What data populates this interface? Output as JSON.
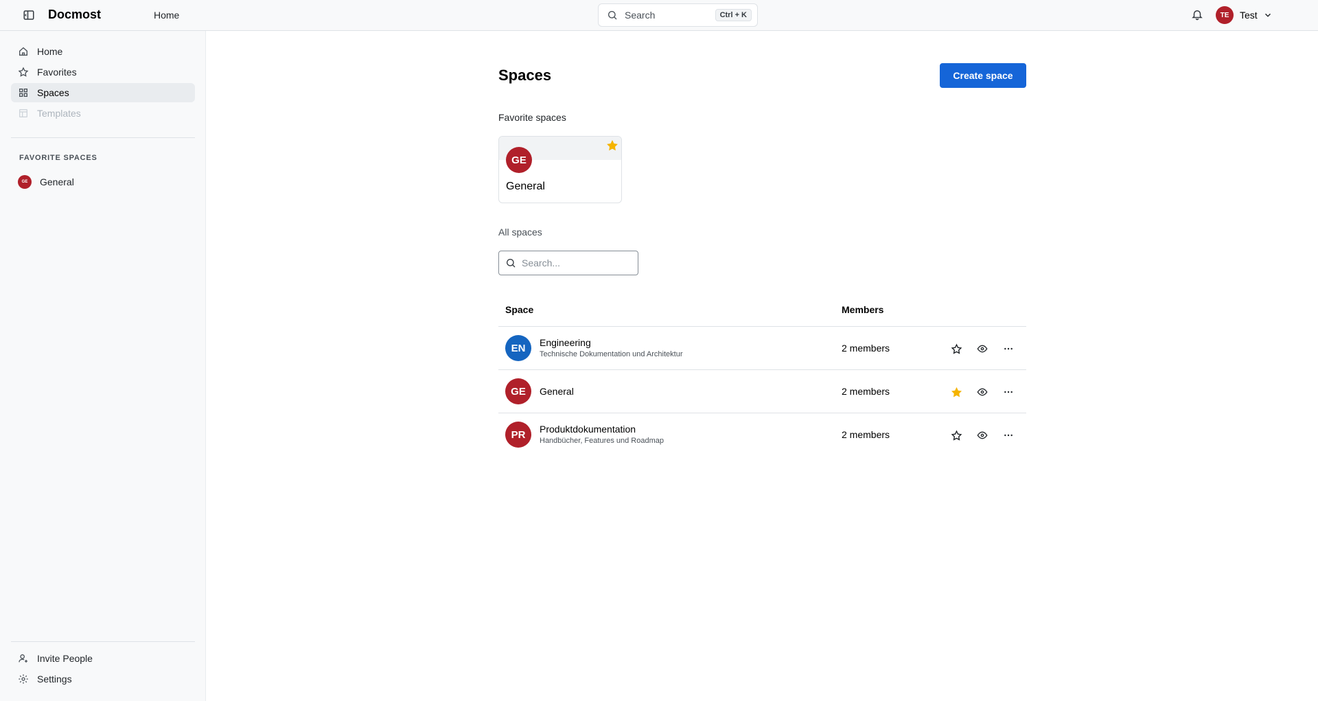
{
  "app": {
    "brand": "Docmost"
  },
  "header": {
    "home_link": "Home",
    "search_label": "Search",
    "search_shortcut": "Ctrl + K",
    "user_initials": "TE",
    "user_name": "Test"
  },
  "sidebar": {
    "nav": [
      {
        "label": "Home",
        "icon": "home-icon"
      },
      {
        "label": "Favorites",
        "icon": "star-icon"
      },
      {
        "label": "Spaces",
        "icon": "grid-icon",
        "active": true
      },
      {
        "label": "Templates",
        "icon": "template-icon",
        "disabled": true
      }
    ],
    "favorite_spaces_title": "FAVORITE SPACES",
    "favorite_spaces": [
      {
        "initials": "GE",
        "label": "General"
      }
    ],
    "bottom": [
      {
        "label": "Invite People",
        "icon": "user-plus-icon"
      },
      {
        "label": "Settings",
        "icon": "gear-icon"
      }
    ]
  },
  "main": {
    "title": "Spaces",
    "create_button": "Create space",
    "favorite_spaces_title": "Favorite spaces",
    "favorite_card": {
      "initials": "GE",
      "name": "General"
    },
    "all_spaces_title": "All spaces",
    "search_placeholder": "Search...",
    "table": {
      "columns": [
        "Space",
        "Members"
      ],
      "rows": [
        {
          "initials": "EN",
          "name": "Engineering",
          "description": "Technische Dokumentation und Architektur",
          "members": "2 members",
          "favorite": false
        },
        {
          "initials": "GE",
          "name": "General",
          "description": "",
          "members": "2 members",
          "favorite": true
        },
        {
          "initials": "PR",
          "name": "Produktdokumentation",
          "description": "Handbücher, Features und Roadmap",
          "members": "2 members",
          "favorite": false
        }
      ]
    }
  },
  "colors": {
    "accent": "#1565d8",
    "avatar_red": "#b0202a",
    "avatar_blue": "#1565c0",
    "star_yellow": "#f5b400"
  }
}
